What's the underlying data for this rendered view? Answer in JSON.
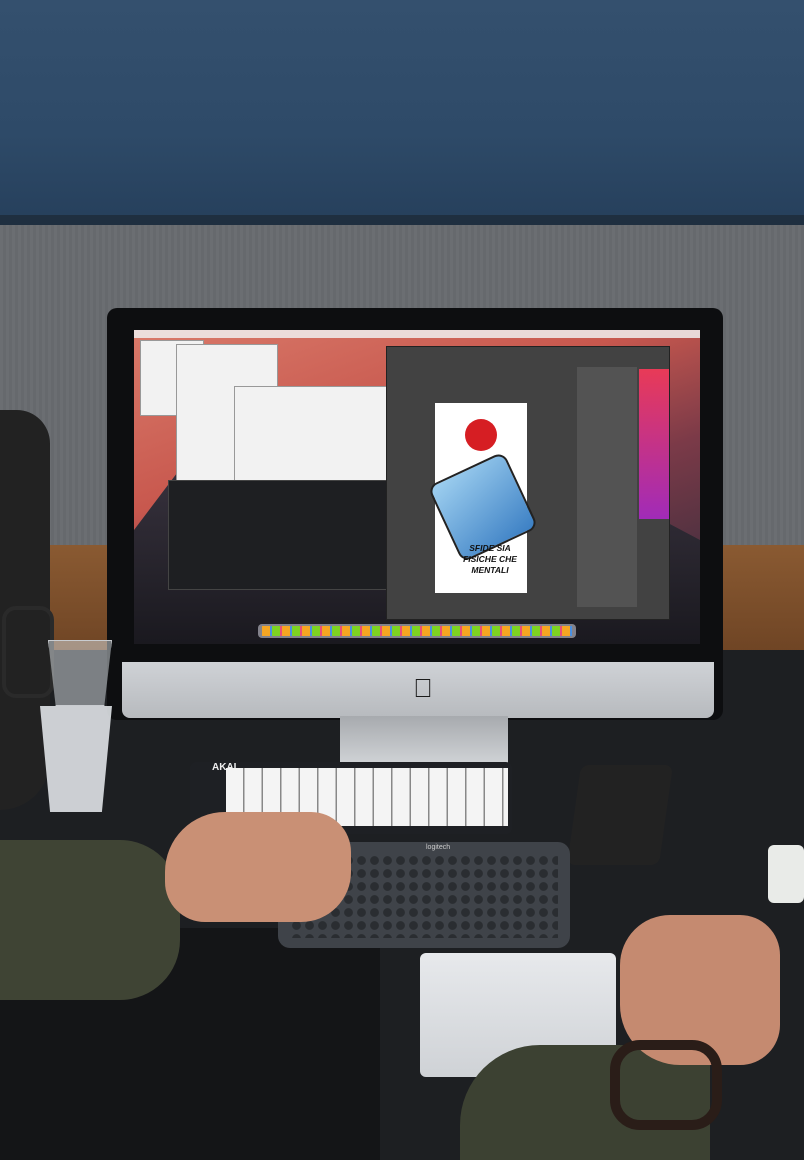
{
  "scene": {
    "description_type": "photo",
    "screen": {
      "poster_text_lines": [
        "SFIDE SIA",
        "FISICHE CHE",
        "MENTALI"
      ]
    },
    "monitor_logo": "apple-logo",
    "midi_brand": "AKAI",
    "keyboard_brand": "logitech"
  }
}
